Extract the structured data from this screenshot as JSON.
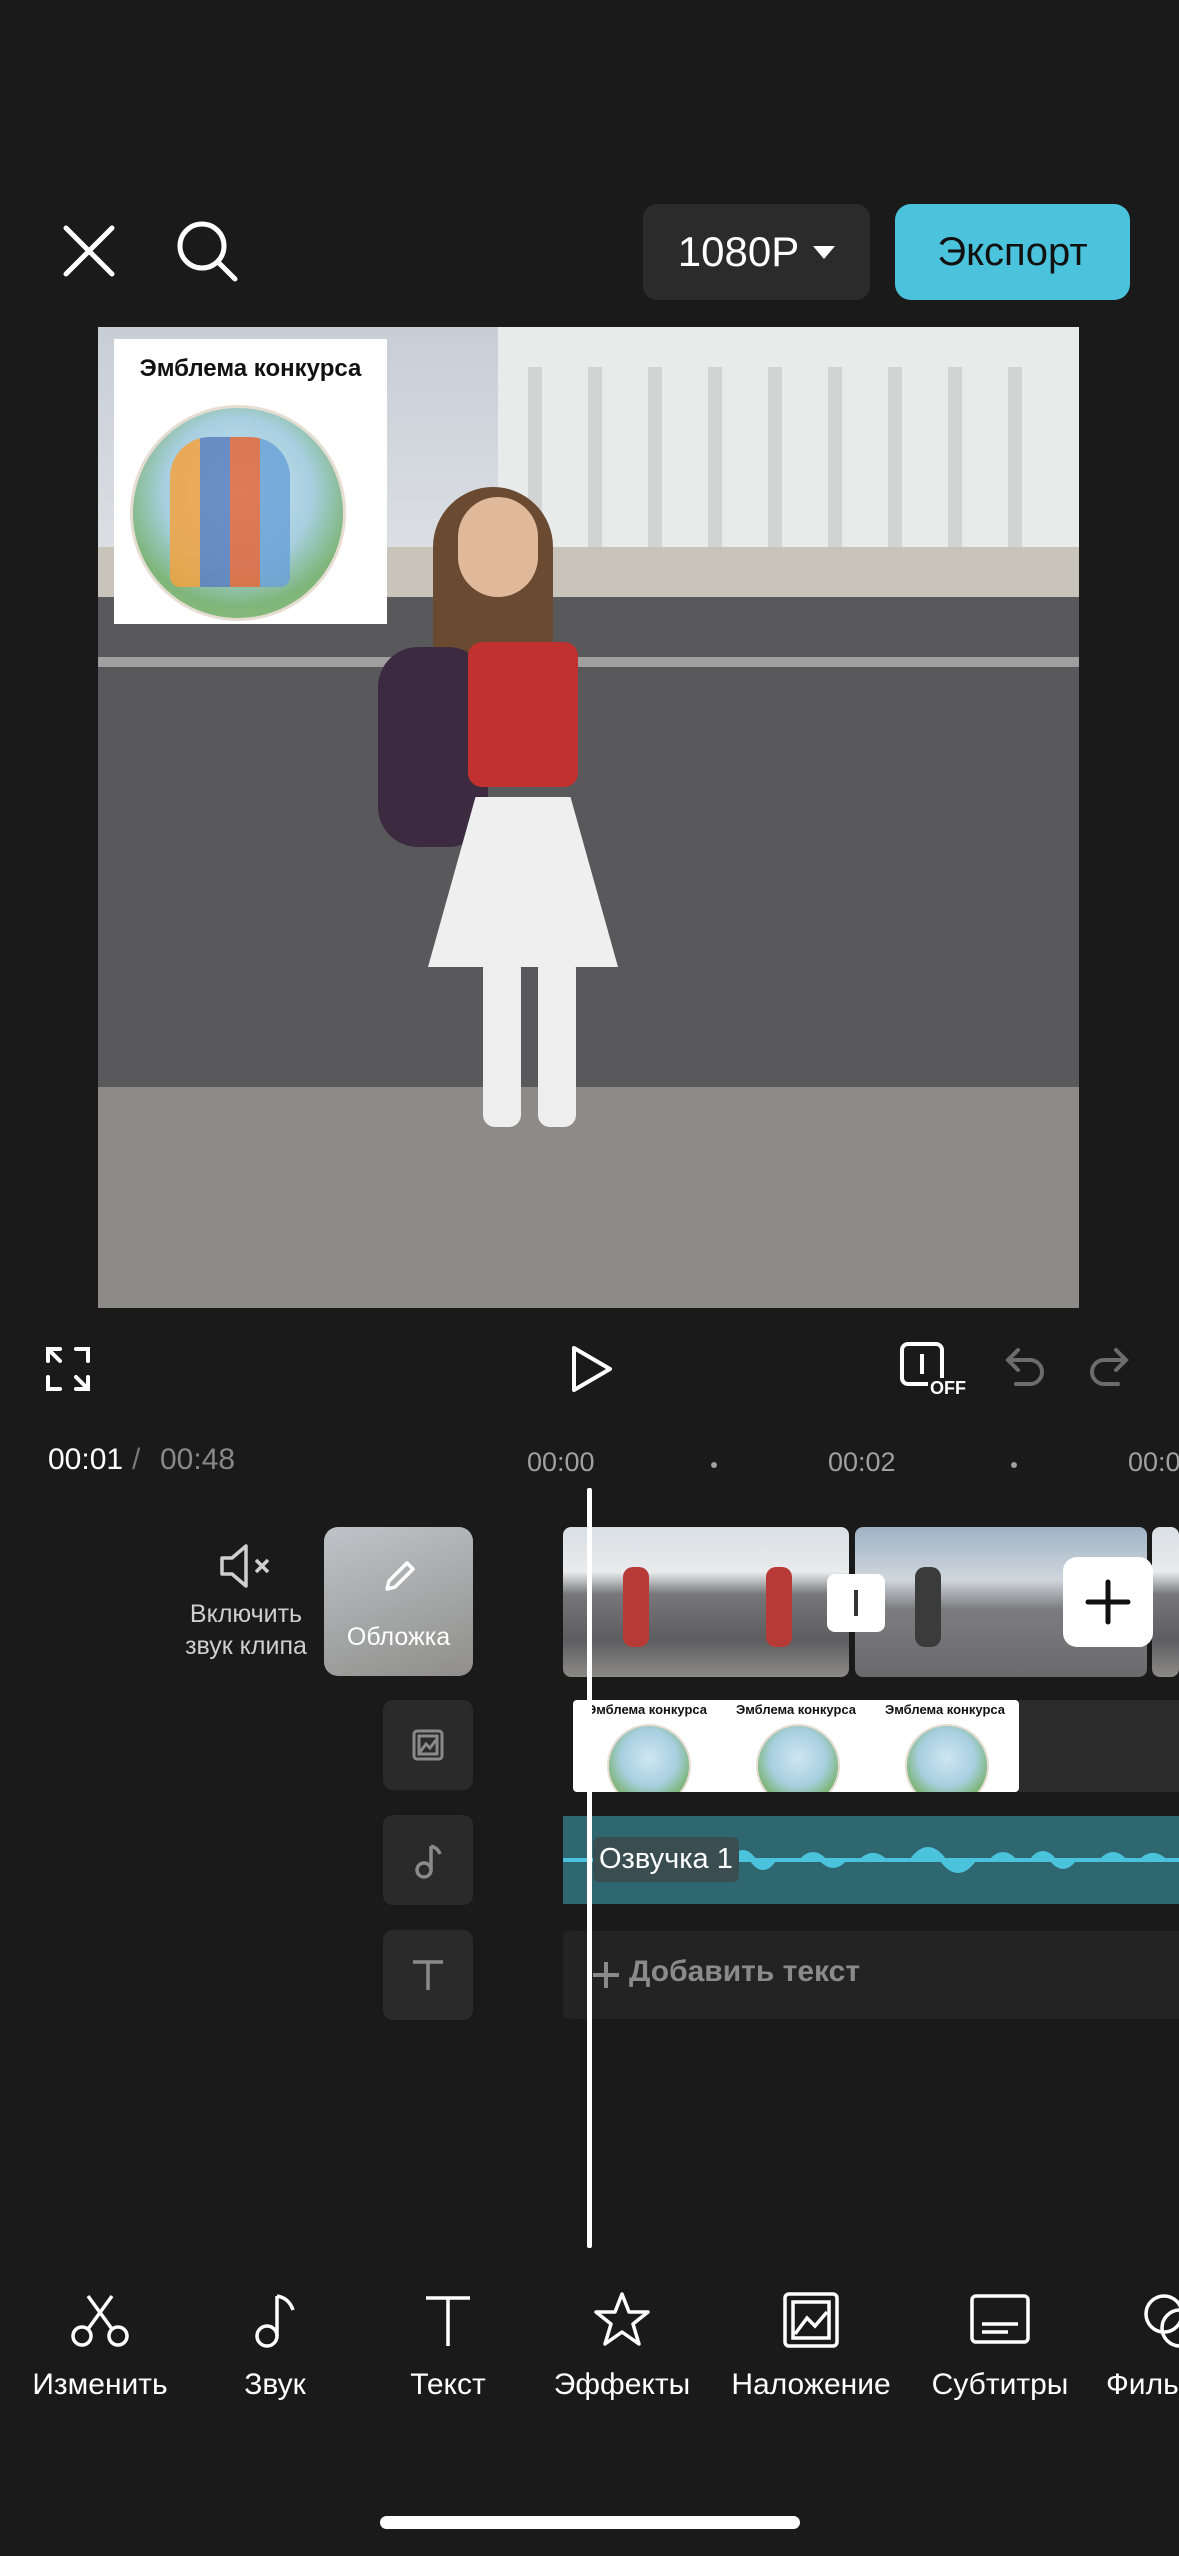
{
  "header": {
    "close_icon": "close-icon",
    "search_icon": "search-icon",
    "resolution": "1080P",
    "export_label": "Экспорт",
    "accent_color": "#4bc3dc"
  },
  "preview": {
    "emblem_title": "Эмблема конкурса"
  },
  "player": {
    "current_time": "00:01",
    "separator": "/",
    "total_time": "00:48",
    "keyframe_badge": "OFF"
  },
  "ruler": {
    "ticks": [
      "00:00",
      "00:02",
      "00:0"
    ]
  },
  "timeline": {
    "mute_label": "Включить звук клипа",
    "cover_label": "Обложка",
    "overlay_title": "Эмблема конкурса",
    "audio_label": "Озвучка 1",
    "add_text_label": "Добавить текст"
  },
  "toolbar": {
    "items": [
      {
        "label": "Изменить",
        "icon": "scissors-icon"
      },
      {
        "label": "Звук",
        "icon": "music-note-icon"
      },
      {
        "label": "Текст",
        "icon": "text-icon"
      },
      {
        "label": "Эффекты",
        "icon": "star-effects-icon"
      },
      {
        "label": "Наложение",
        "icon": "overlay-icon"
      },
      {
        "label": "Субтитры",
        "icon": "subtitles-icon"
      },
      {
        "label": "Филь",
        "icon": "filters-icon"
      }
    ]
  }
}
